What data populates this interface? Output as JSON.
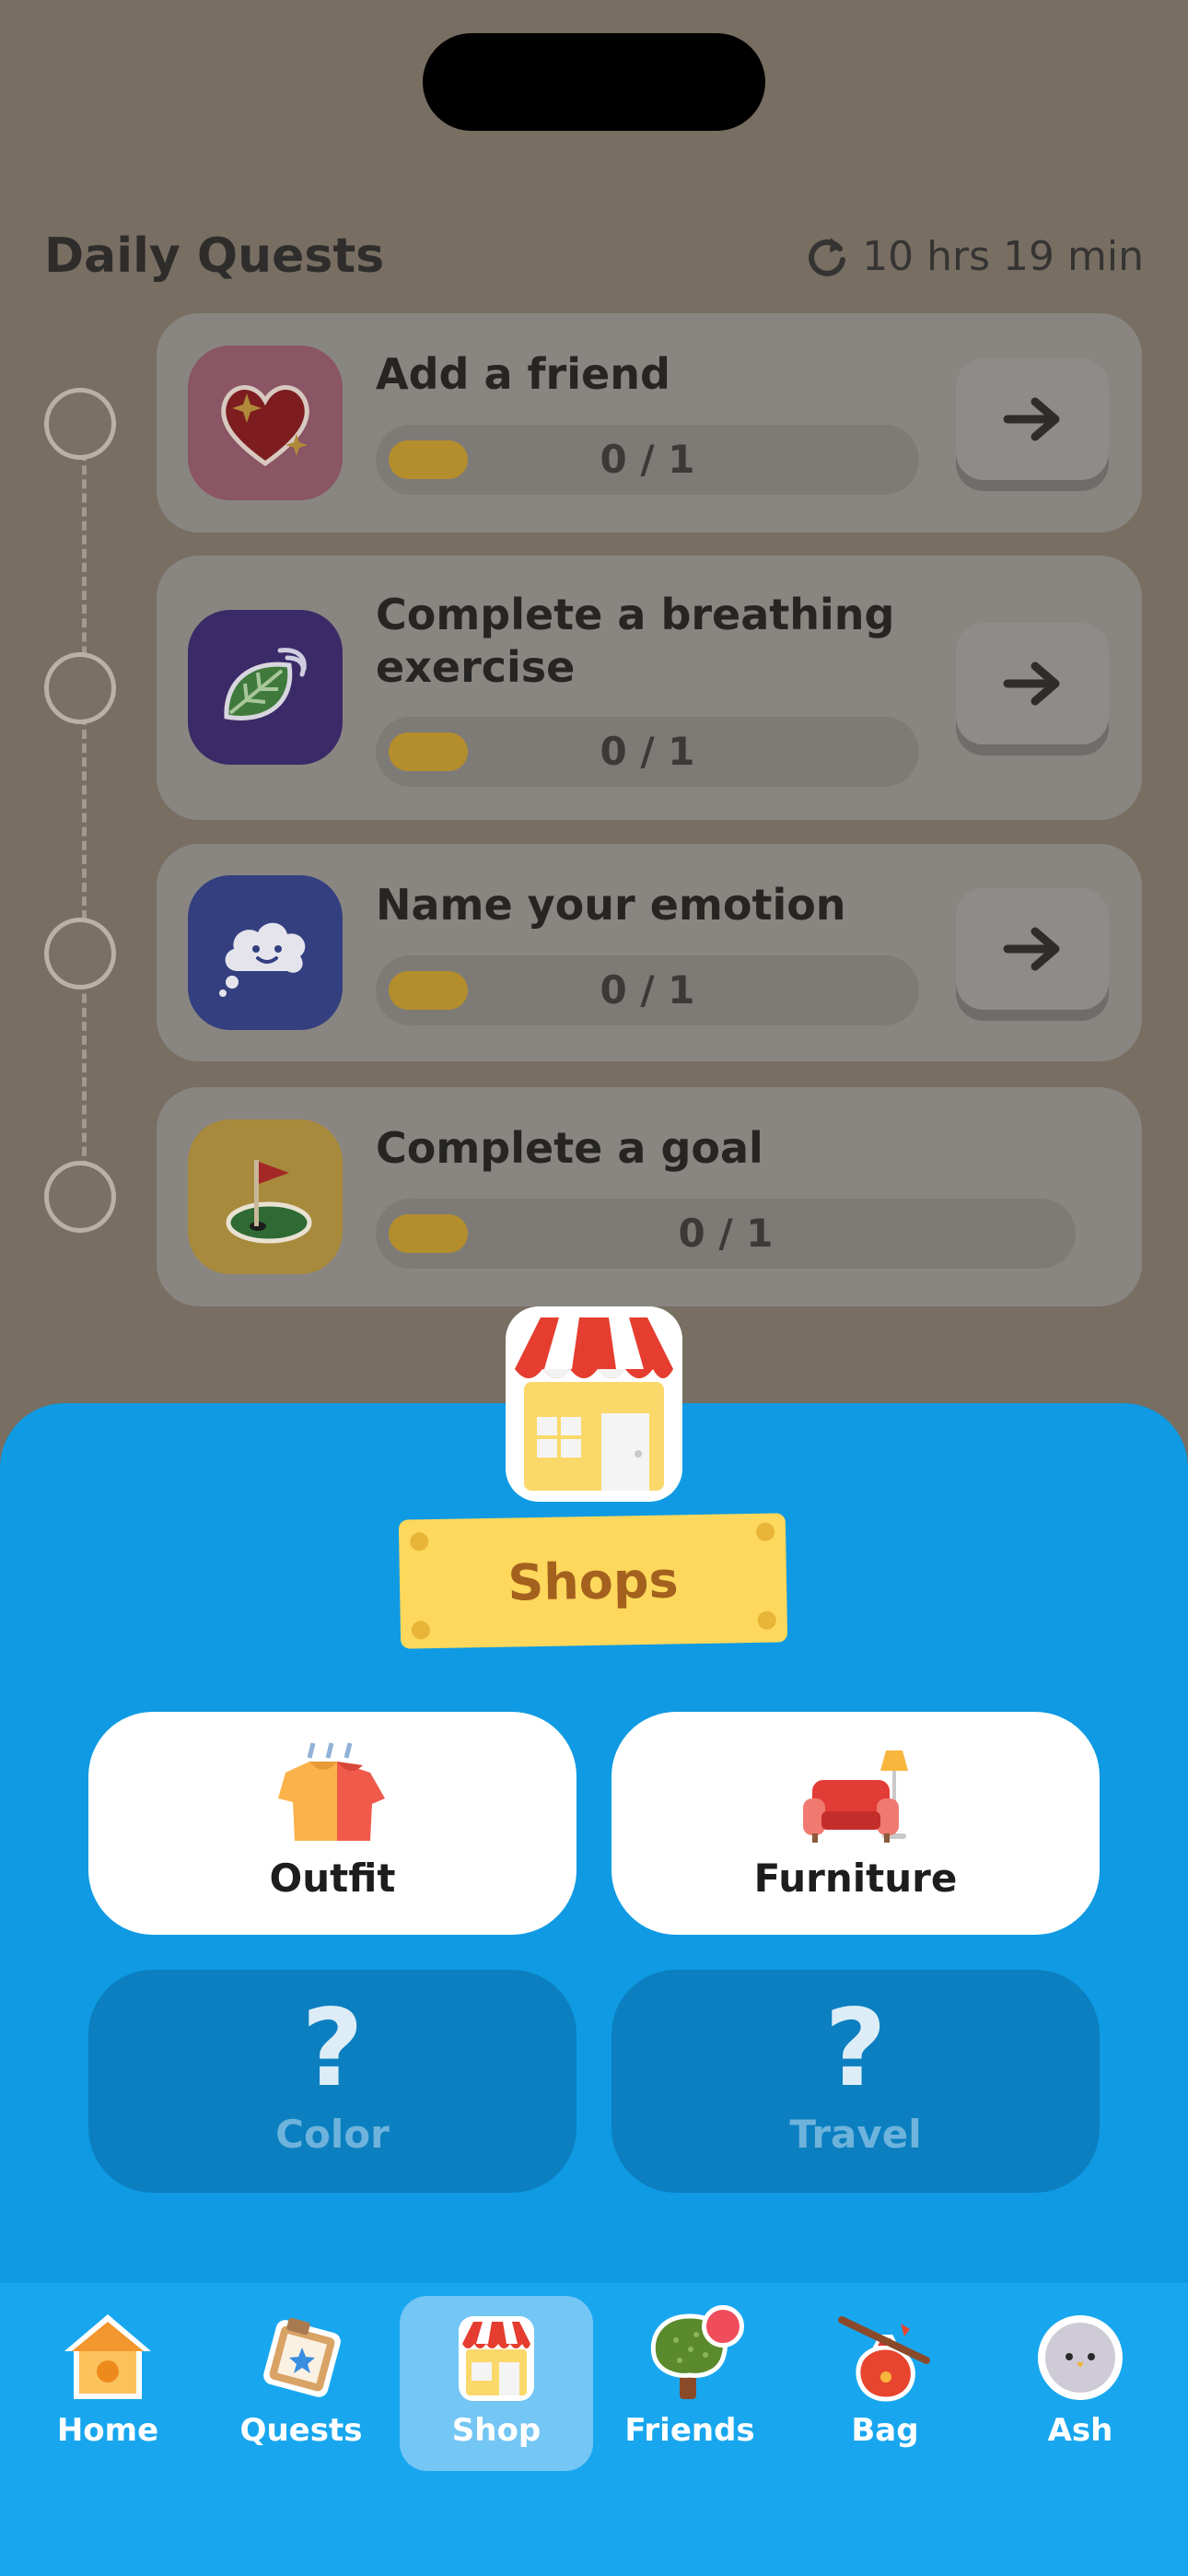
{
  "quests": {
    "title": "Daily Quests",
    "timer": "10 hrs 19 min",
    "items": [
      {
        "title": "Add a friend",
        "progress": "0 / 1",
        "icon": "heart-sparkle-icon"
      },
      {
        "title": "Complete a breathing exercise",
        "progress": "0 / 1",
        "icon": "leaf-wind-icon"
      },
      {
        "title": "Name your emotion",
        "progress": "0 / 1",
        "icon": "cloud-face-icon"
      },
      {
        "title": "Complete a goal",
        "progress": "0 / 1",
        "icon": "golf-flag-icon"
      }
    ]
  },
  "shops": {
    "title": "Shops",
    "options": [
      {
        "label": "Outfit",
        "unlocked": true,
        "icon": "outfit-icon"
      },
      {
        "label": "Furniture",
        "unlocked": true,
        "icon": "furniture-icon"
      },
      {
        "label": "Color",
        "unlocked": false,
        "icon": "question-mark-icon"
      },
      {
        "label": "Travel",
        "unlocked": false,
        "icon": "question-mark-icon"
      }
    ]
  },
  "tabs": [
    {
      "label": "Home",
      "icon": "birdhouse-icon"
    },
    {
      "label": "Quests",
      "icon": "quest-board-icon"
    },
    {
      "label": "Shop",
      "icon": "shop-icon",
      "active": true
    },
    {
      "label": "Friends",
      "icon": "tree-icon",
      "notification": true
    },
    {
      "label": "Bag",
      "icon": "bag-icon"
    },
    {
      "label": "Ash",
      "icon": "bird-avatar-icon"
    }
  ],
  "colors": {
    "accent": "#0f9ae3",
    "tabbar": "#18a7ef",
    "label": "#fdd85c"
  }
}
